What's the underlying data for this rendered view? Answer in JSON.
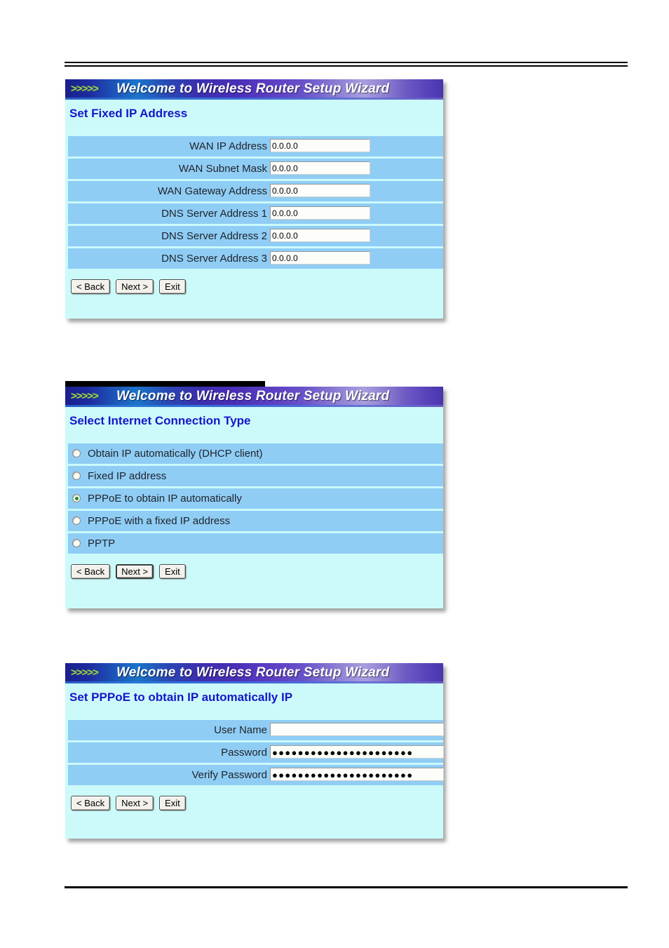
{
  "document": {
    "rule_top": "double-rule",
    "rule_bottom": "single-rule"
  },
  "wizard_title": "Welcome to Wireless Router Setup Wizard",
  "chevrons": ">>>>>",
  "buttons": {
    "back": "< Back",
    "next": "Next >",
    "exit": "Exit"
  },
  "panels": [
    {
      "section_title": "Set Fixed IP Address",
      "type": "fields",
      "rows": [
        {
          "label": "WAN IP Address",
          "value": "0.0.0.0"
        },
        {
          "label": "WAN Subnet Mask",
          "value": "0.0.0.0"
        },
        {
          "label": "WAN Gateway Address",
          "value": "0.0.0.0"
        },
        {
          "label": "DNS Server Address 1",
          "value": "0.0.0.0"
        },
        {
          "label": "DNS Server Address 2",
          "value": "0.0.0.0"
        },
        {
          "label": "DNS Server Address 3",
          "value": "0.0.0.0"
        }
      ]
    },
    {
      "section_title": "Select Internet Connection Type",
      "type": "radios",
      "options": [
        {
          "label": "Obtain IP automatically (DHCP client)",
          "selected": false
        },
        {
          "label": "Fixed IP address",
          "selected": false
        },
        {
          "label": "PPPoE to obtain IP automatically",
          "selected": true
        },
        {
          "label": "PPPoE with a fixed IP address",
          "selected": false
        },
        {
          "label": "PPTP",
          "selected": false
        }
      ]
    },
    {
      "section_title": "Set PPPoE to obtain IP automatically IP",
      "type": "fields",
      "rows": [
        {
          "label": "User Name",
          "value": ""
        },
        {
          "label": "Password",
          "value": "●●●●●●●●●●●●●●●●●●●●●●"
        },
        {
          "label": "Verify Password",
          "value": "●●●●●●●●●●●●●●●●●●●●●●"
        }
      ]
    }
  ],
  "colors": {
    "panel_body": "#ccfafa",
    "row_blue": "#8fcdf5",
    "section_title": "#1616c8",
    "chevron_green": "#9bd34a",
    "radio_dot": "#1f8c1f"
  }
}
